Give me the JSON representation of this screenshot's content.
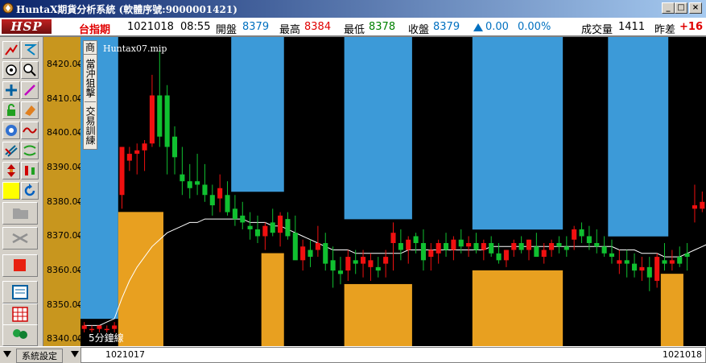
{
  "window": {
    "title": "HuntaX期貨分析系統 (軟體序號:9000001421)"
  },
  "quote": {
    "logo": "HSP",
    "symbol": "台指期",
    "date": "1021018",
    "time": "08:55",
    "open_label": "開盤",
    "open": "8379",
    "high_label": "最高",
    "high": "8384",
    "low_label": "最低",
    "low": "8378",
    "close_label": "收盤",
    "close": "8379",
    "change": "0.00",
    "change_pct": "0.00%",
    "volume_label": "成交量",
    "volume": "1411",
    "diff_label": "昨差",
    "diff": "+16"
  },
  "chart": {
    "study_name": "Huntax07.mip",
    "period_label": "5分鐘線",
    "y_ticks": [
      "8420.00",
      "8410.00",
      "8400.00",
      "8390.00",
      "8380.00",
      "8370.00",
      "8360.00",
      "8350.00",
      "8340.00"
    ],
    "menu_items": [
      "商",
      "當沖狙擊",
      "交易訓練"
    ]
  },
  "status": {
    "settings_label": "系統設定",
    "start_date": "1021017",
    "end_date": "1021018"
  },
  "colors": {
    "up": "#f01010",
    "down": "#10c030",
    "orange": "#e8a020",
    "blue": "#3c9ad8",
    "ma": "#ffffff"
  },
  "chart_data": {
    "type": "candlestick",
    "ylim": [
      8338,
      8428
    ],
    "candles": [
      [
        8343,
        8345,
        8342,
        8344
      ],
      [
        8343,
        8344,
        8342,
        8343
      ],
      [
        8343,
        8344,
        8342,
        8344
      ],
      [
        8343,
        8344,
        8342,
        8343
      ],
      [
        8343,
        8345,
        8342,
        8344
      ],
      [
        8382,
        8396,
        8378,
        8396
      ],
      [
        8392,
        8396,
        8389,
        8394
      ],
      [
        8394,
        8397,
        8388,
        8395
      ],
      [
        8395,
        8398,
        8389,
        8397
      ],
      [
        8397,
        8417,
        8396,
        8411
      ],
      [
        8411,
        8424,
        8396,
        8399
      ],
      [
        8411,
        8414,
        8388,
        8396
      ],
      [
        8399,
        8402,
        8388,
        8393
      ],
      [
        8388,
        8396,
        8382,
        8386
      ],
      [
        8386,
        8391,
        8381,
        8384
      ],
      [
        8386,
        8394,
        8382,
        8385
      ],
      [
        8385,
        8391,
        8380,
        8382
      ],
      [
        8382,
        8385,
        8376,
        8379
      ],
      [
        8381,
        8388,
        8377,
        8384
      ],
      [
        8382,
        8386,
        8376,
        8377
      ],
      [
        8378,
        8382,
        8373,
        8375
      ],
      [
        8376,
        8380,
        8372,
        8374
      ],
      [
        8373,
        8377,
        8369,
        8372
      ],
      [
        8372,
        8376,
        8368,
        8370
      ],
      [
        8370,
        8374,
        8366,
        8373
      ],
      [
        8374,
        8378,
        8370,
        8371
      ],
      [
        8371,
        8377,
        8367,
        8376
      ],
      [
        8375,
        8377,
        8369,
        8370
      ],
      [
        8371,
        8376,
        8364,
        8363
      ],
      [
        8363,
        8369,
        8360,
        8367
      ],
      [
        8366,
        8369,
        8361,
        8364
      ],
      [
        8366,
        8373,
        8364,
        8368
      ],
      [
        8368,
        8371,
        8360,
        8362
      ],
      [
        8363,
        8367,
        8355,
        8360
      ],
      [
        8360,
        8364,
        8356,
        8359
      ],
      [
        8360,
        8366,
        8357,
        8364
      ],
      [
        8363,
        8366,
        8359,
        8362
      ],
      [
        8362,
        8366,
        8358,
        8364
      ],
      [
        8361,
        8365,
        8357,
        8363
      ],
      [
        8361,
        8364,
        8358,
        8360
      ],
      [
        8362,
        8366,
        8358,
        8364
      ],
      [
        8368,
        8374,
        8360,
        8371
      ],
      [
        8368,
        8372,
        8363,
        8366
      ],
      [
        8366,
        8370,
        8362,
        8369
      ],
      [
        8370,
        8371,
        8365,
        8368
      ],
      [
        8368,
        8372,
        8360,
        8363
      ],
      [
        8364,
        8368,
        8360,
        8366
      ],
      [
        8365,
        8369,
        8362,
        8368
      ],
      [
        8368,
        8371,
        8364,
        8366
      ],
      [
        8366,
        8370,
        8363,
        8369
      ],
      [
        8369,
        8372,
        8365,
        8367
      ],
      [
        8367,
        8370,
        8364,
        8368
      ],
      [
        8368,
        8371,
        8365,
        8366
      ],
      [
        8366,
        8369,
        8363,
        8368
      ],
      [
        8368,
        8370,
        8364,
        8365
      ],
      [
        8365,
        8368,
        8362,
        8363
      ],
      [
        8363,
        8366,
        8361,
        8366
      ],
      [
        8366,
        8369,
        8364,
        8368
      ],
      [
        8368,
        8370,
        8365,
        8366
      ],
      [
        8366,
        8369,
        8363,
        8369
      ],
      [
        8367,
        8371,
        8364,
        8364
      ],
      [
        8364,
        8368,
        8362,
        8366
      ],
      [
        8366,
        8369,
        8364,
        8368
      ],
      [
        8368,
        8370,
        8365,
        8367
      ],
      [
        8367,
        8370,
        8364,
        8366
      ],
      [
        8369,
        8373,
        8366,
        8372
      ],
      [
        8372,
        8374,
        8368,
        8370
      ],
      [
        8370,
        8373,
        8366,
        8368
      ],
      [
        8368,
        8372,
        8365,
        8367
      ],
      [
        8367,
        8370,
        8364,
        8365
      ],
      [
        8365,
        8369,
        8362,
        8364
      ],
      [
        8362,
        8366,
        8359,
        8363
      ],
      [
        8363,
        8366,
        8358,
        8362
      ],
      [
        8362,
        8365,
        8358,
        8360
      ],
      [
        8360,
        8364,
        8357,
        8361
      ],
      [
        8361,
        8364,
        8354,
        8358
      ],
      [
        8357,
        8365,
        8355,
        8364
      ],
      [
        8363,
        8368,
        8360,
        8362
      ],
      [
        8362,
        8366,
        8360,
        8363
      ],
      [
        8364,
        8367,
        8361,
        8362
      ],
      [
        8365,
        8368,
        8360,
        8364
      ],
      [
        8378,
        8385,
        8374,
        8379
      ],
      [
        8378,
        8383,
        8377,
        8380
      ]
    ],
    "ma": [
      8344,
      8344,
      8344,
      8345,
      8346,
      8352,
      8357,
      8361,
      8364,
      8367,
      8369,
      8371,
      8372,
      8373,
      8374,
      8374,
      8375,
      8375,
      8375,
      8375,
      8375,
      8375,
      8374,
      8374,
      8374,
      8373,
      8373,
      8372,
      8371,
      8370,
      8369,
      8368,
      8367,
      8366,
      8366,
      8366,
      8365,
      8365,
      8365,
      8365,
      8365,
      8365,
      8365,
      8366,
      8366,
      8366,
      8366,
      8366,
      8366,
      8366,
      8366,
      8366,
      8366,
      8366,
      8367,
      8367,
      8367,
      8367,
      8367,
      8367,
      8367,
      8367,
      8367,
      8367,
      8367,
      8367,
      8367,
      8367,
      8367,
      8367,
      8367,
      8366,
      8366,
      8366,
      8365,
      8365,
      8365,
      8364,
      8364,
      8364,
      8365,
      8366,
      8367,
      8368
    ]
  }
}
